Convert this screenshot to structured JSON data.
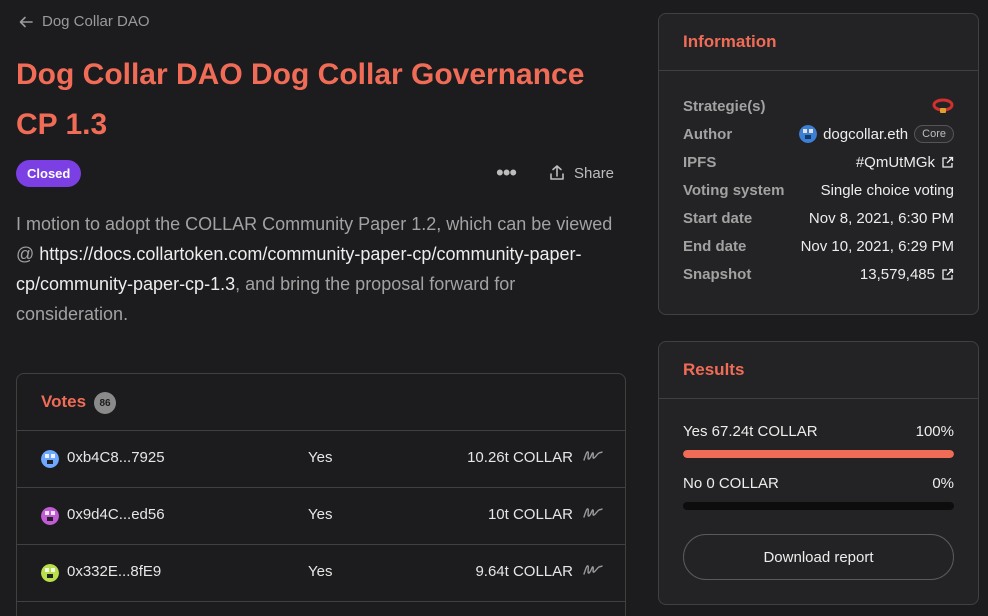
{
  "nav": {
    "back_label": "Dog Collar DAO"
  },
  "proposal": {
    "title": "Dog Collar DAO Dog Collar Governance CP 1.3",
    "state": "Closed",
    "more_label": "•••",
    "share_label": "Share",
    "body_before": "I motion to adopt the COLLAR Community Paper 1.2, which can be viewed @ ",
    "body_link": "https://docs.collartoken.com/community-paper-cp/community-paper-cp/community-paper-cp-1.3",
    "body_after": ", and bring the proposal forward for consideration."
  },
  "votes": {
    "label": "Votes",
    "count": "86",
    "rows": [
      {
        "address": "0xb4C8...7925",
        "choice": "Yes",
        "power": "10.26t COLLAR",
        "avatar_color": "#6fa8ff"
      },
      {
        "address": "0x9d4C...ed56",
        "choice": "Yes",
        "power": "10t COLLAR",
        "avatar_color": "#c45bd6"
      },
      {
        "address": "0x332E...8fE9",
        "choice": "Yes",
        "power": "9.64t COLLAR",
        "avatar_color": "#b7e04a"
      }
    ]
  },
  "information": {
    "heading": "Information",
    "strategies_label": "Strategie(s)",
    "author_label": "Author",
    "author_value": "dogcollar.eth",
    "author_badge": "Core",
    "ipfs_label": "IPFS",
    "ipfs_value": "#QmUtMGk",
    "voting_system_label": "Voting system",
    "voting_system_value": "Single choice voting",
    "start_label": "Start date",
    "start_value": "Nov 8, 2021, 6:30 PM",
    "end_label": "End date",
    "end_value": "Nov 10, 2021, 6:29 PM",
    "snapshot_label": "Snapshot",
    "snapshot_value": "13,579,485"
  },
  "results": {
    "heading": "Results",
    "options": [
      {
        "label": "Yes 67.24t COLLAR",
        "percent_label": "100%",
        "fraction": 1.0
      },
      {
        "label": "No 0 COLLAR",
        "percent_label": "0%",
        "fraction": 0.0
      }
    ],
    "download_label": "Download report"
  },
  "colors": {
    "accent": "#f06c57",
    "closed_badge": "#7b3fe4",
    "background": "#1c1b1e"
  }
}
